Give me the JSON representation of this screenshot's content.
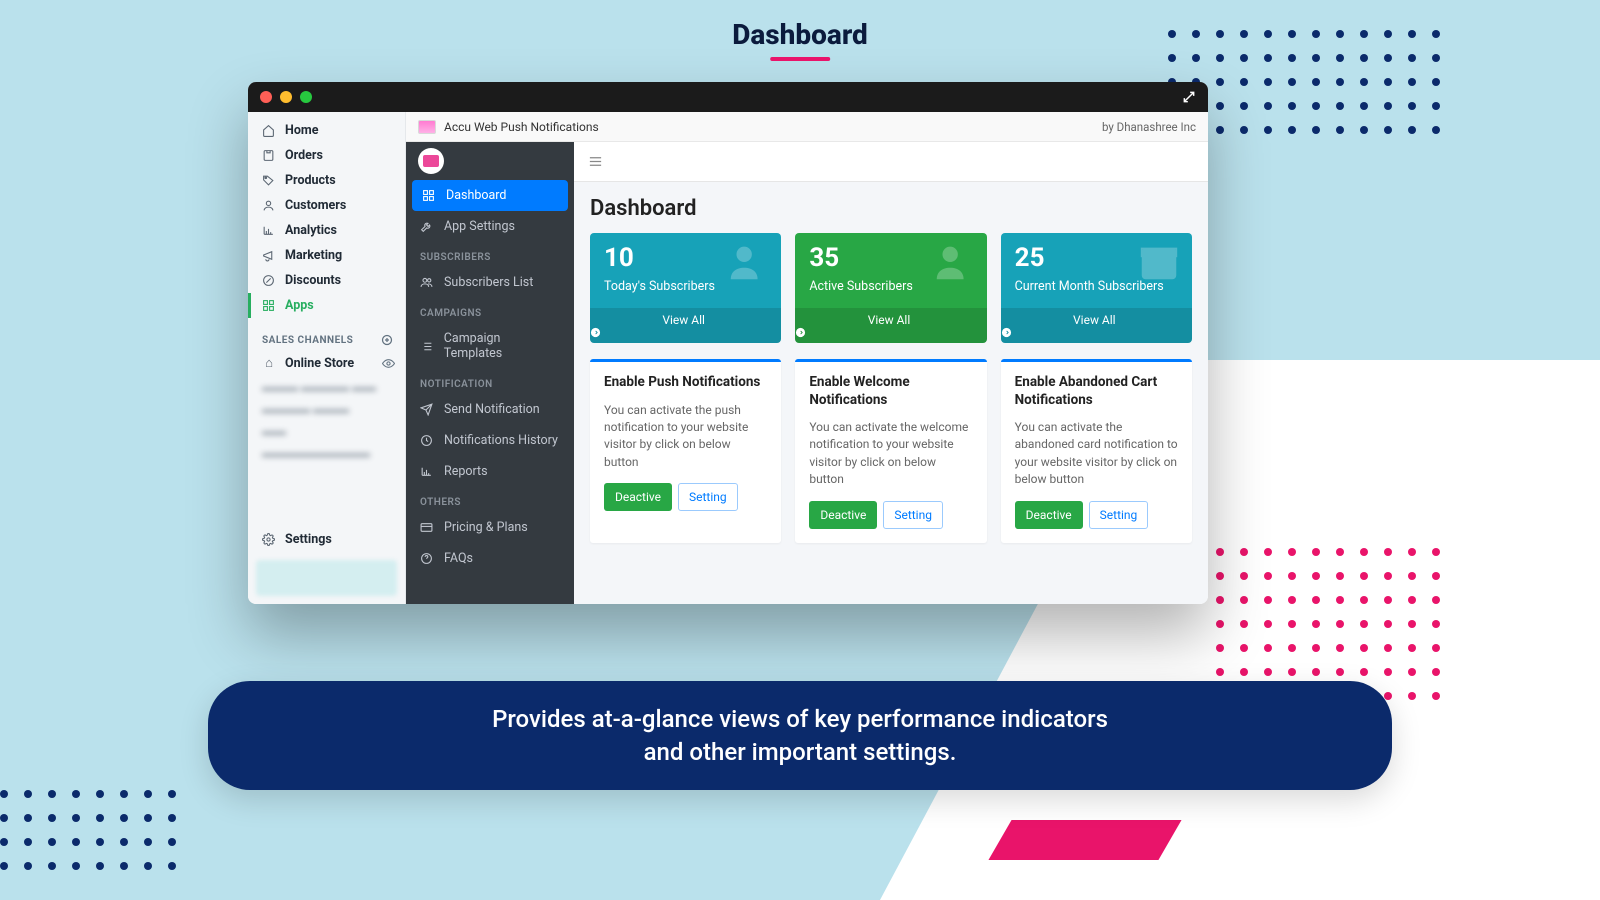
{
  "promo": {
    "title": "Dashboard",
    "caption_line1": "Provides at-a-glance views of key performance indicators",
    "caption_line2": "and other important settings."
  },
  "window": {
    "app_title": "Accu Web Push Notifications",
    "by_label": "by Dhanashree Inc"
  },
  "shop_nav": {
    "items": [
      {
        "label": "Home",
        "icon": "home"
      },
      {
        "label": "Orders",
        "icon": "orders"
      },
      {
        "label": "Products",
        "icon": "tag"
      },
      {
        "label": "Customers",
        "icon": "user"
      },
      {
        "label": "Analytics",
        "icon": "chart"
      },
      {
        "label": "Marketing",
        "icon": "horn"
      },
      {
        "label": "Discounts",
        "icon": "discount"
      },
      {
        "label": "Apps",
        "icon": "apps",
        "active": true
      }
    ],
    "section_header": "SALES CHANNELS",
    "channel": "Online Store",
    "settings": "Settings"
  },
  "app_side": {
    "items_top": [
      {
        "label": "Dashboard",
        "icon": "grid",
        "active": true
      },
      {
        "label": "App Settings",
        "icon": "wrench"
      }
    ],
    "groups": [
      {
        "header": "SUBSCRIBERS",
        "items": [
          {
            "label": "Subscribers List",
            "icon": "users"
          }
        ]
      },
      {
        "header": "CAMPAIGNS",
        "items": [
          {
            "label": "Campaign Templates",
            "icon": "list"
          }
        ]
      },
      {
        "header": "NOTIFICATION",
        "items": [
          {
            "label": "Send Notification",
            "icon": "send"
          },
          {
            "label": "Notifications History",
            "icon": "history"
          },
          {
            "label": "Reports",
            "icon": "chart"
          }
        ]
      },
      {
        "header": "OTHERS",
        "items": [
          {
            "label": "Pricing & Plans",
            "icon": "credit"
          },
          {
            "label": "FAQs",
            "icon": "help"
          }
        ]
      }
    ]
  },
  "main": {
    "heading": "Dashboard",
    "stats": [
      {
        "value": "10",
        "label": "Today's Subscribers",
        "color": "teal",
        "icon": "user-clock",
        "view": "View All"
      },
      {
        "value": "35",
        "label": "Active Subscribers",
        "color": "green",
        "icon": "user-check",
        "view": "View All"
      },
      {
        "value": "25",
        "label": "Current Month Subscribers",
        "color": "teal",
        "icon": "calendar",
        "view": "View All"
      }
    ],
    "cards": [
      {
        "title": "Enable Push Notifications",
        "body": "You can activate the push notification to your website visitor by click on below button",
        "deactive": "Deactive",
        "setting": "Setting"
      },
      {
        "title": "Enable Welcome Notifications",
        "body": "You can activate the welcome notification to your website visitor by click on below button",
        "deactive": "Deactive",
        "setting": "Setting"
      },
      {
        "title": "Enable Abandoned Cart Notifications",
        "body": "You can activate the abandoned card notification to your website visitor by click on below button",
        "deactive": "Deactive",
        "setting": "Setting"
      }
    ]
  }
}
